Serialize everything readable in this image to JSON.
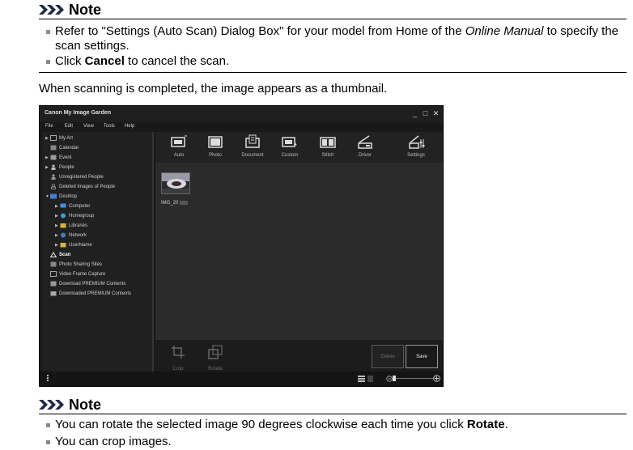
{
  "note1": {
    "title": "Note",
    "item1": {
      "pre": "Refer to \"Settings (Auto Scan) Dialog Box\" for your model from Home of the ",
      "italic": "Online Manual",
      "post": " to specify the scan settings."
    },
    "item2": {
      "pre": "Click ",
      "bold": "Cancel",
      "post": " to cancel the scan."
    }
  },
  "paragraph": "When scanning is completed, the image appears as a thumbnail.",
  "app": {
    "title": "Canon My Image Garden",
    "window_buttons": [
      "_",
      "□",
      "✕"
    ],
    "menu": [
      "File",
      "Edit",
      "View",
      "Tools",
      "Help"
    ],
    "sidebar": {
      "my_art": "My Art",
      "calendar": "Calendar",
      "event": "Event",
      "people": "People",
      "unregistered_people": "Unregistered People",
      "deleted_images": "Deleted Images of People",
      "desktop": "Desktop",
      "computer": "Computer",
      "homegroup": "Homegroup",
      "libraries": "Libraries",
      "network": "Network",
      "username": "UserName",
      "scan": "Scan",
      "photo_sharing": "Photo Sharing Sites",
      "video_frame": "Video Frame Capture",
      "download_premium": "Download PREMIUM Contents",
      "downloaded_premium": "Downloaded PREMIUM Contents"
    },
    "toolbar": {
      "auto": "Auto",
      "photo": "Photo",
      "document": "Document",
      "custom": "Custom",
      "stitch": "Stitch",
      "driver": "Driver",
      "settings": "Settings"
    },
    "thumbnail_caption": "IMG_20",
    "bottom": {
      "crop": "Crop",
      "rotate": "Rotate",
      "delete": "Delete",
      "save": "Save"
    },
    "colors": {
      "window_bg": "#191919",
      "content_bg": "#2b2b2b",
      "text": "#cfcfcf"
    }
  },
  "note2": {
    "title": "Note",
    "item1": {
      "pre": "You can rotate the selected image 90 degrees clockwise each time you click ",
      "bold": "Rotate",
      "post": "."
    },
    "item2": {
      "text": "You can crop images."
    }
  }
}
